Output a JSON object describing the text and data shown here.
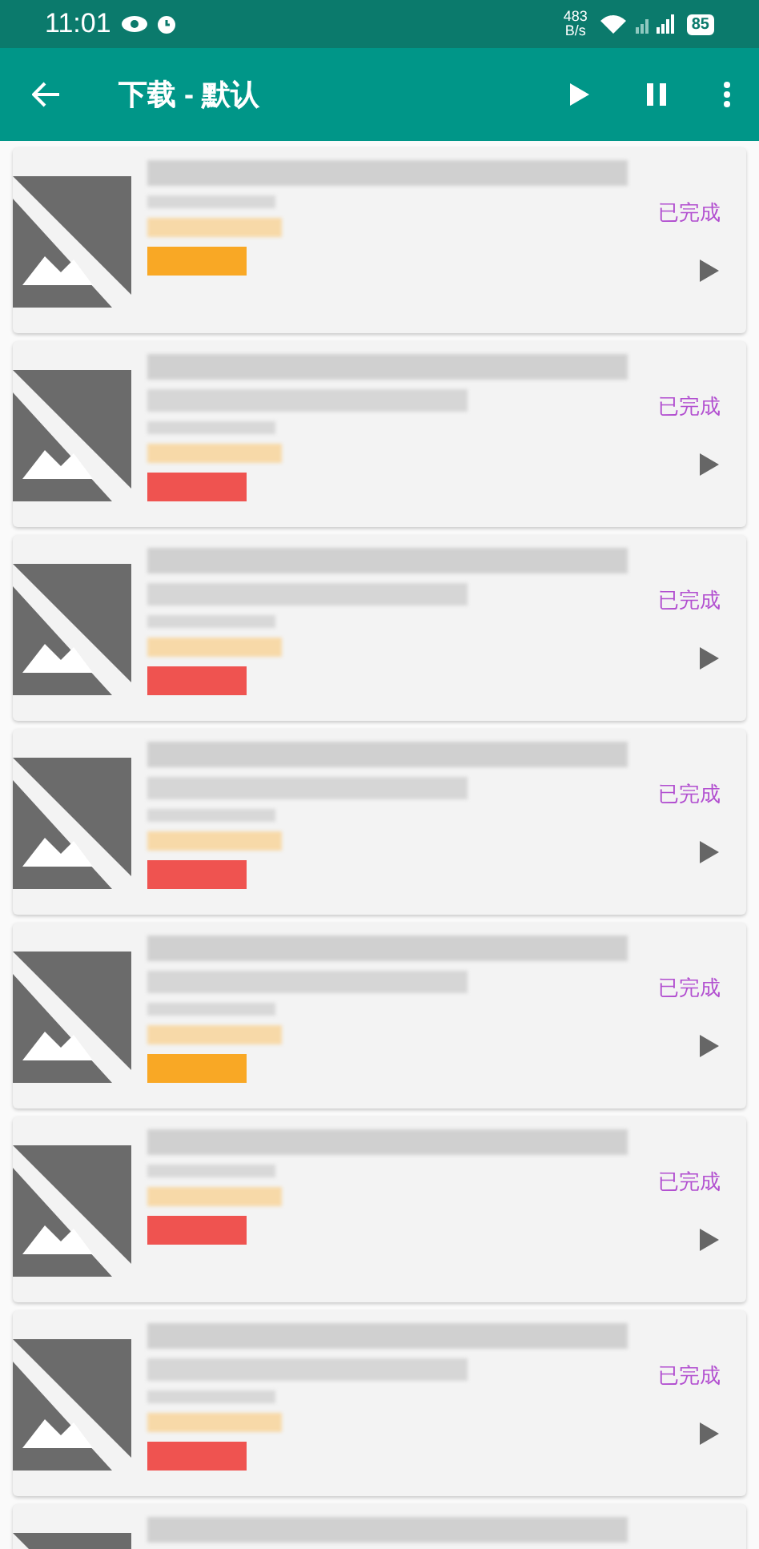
{
  "status_bar": {
    "time": "11:01",
    "net_speed": "483",
    "net_unit": "B/s",
    "battery": "85"
  },
  "toolbar": {
    "title": "下载 - 默认"
  },
  "downloads": [
    {
      "kind": "short",
      "status": "已完成",
      "color": "#f9a825"
    },
    {
      "kind": "long",
      "status": "已完成",
      "color": "#ef5350"
    },
    {
      "kind": "long",
      "status": "已完成",
      "color": "#ef5350"
    },
    {
      "kind": "long",
      "status": "已完成",
      "color": "#ef5350"
    },
    {
      "kind": "long",
      "status": "已完成",
      "color": "#f9a825"
    },
    {
      "kind": "short",
      "status": "已完成",
      "color": "#ef5350"
    },
    {
      "kind": "long",
      "status": "已完成",
      "color": "#ef5350"
    },
    {
      "kind": "cut"
    }
  ]
}
